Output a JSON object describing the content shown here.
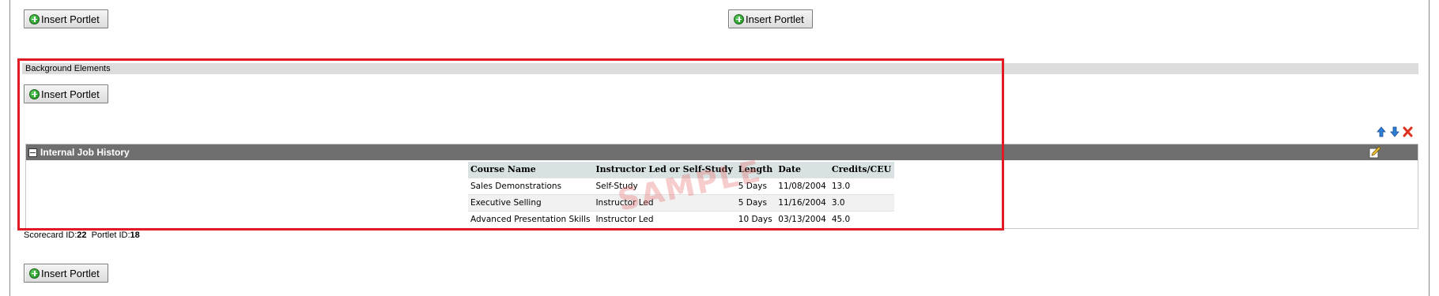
{
  "buttons": {
    "insert_portlet_label": "Insert Portlet"
  },
  "background_section": {
    "title": "Background Elements"
  },
  "portlet": {
    "title": "Internal Job History",
    "table": {
      "headers": [
        "Course Name",
        "Instructor Led or Self-Study",
        "Length",
        "Date",
        "Credits/CEU"
      ],
      "rows": [
        [
          "Sales Demonstrations",
          "Self-Study",
          "5 Days",
          "11/08/2004",
          "13.0"
        ],
        [
          "Executive Selling",
          "Instructor Led",
          "5 Days",
          "11/16/2004",
          "3.0"
        ],
        [
          "Advanced Presentation Skills",
          "Instructor Led",
          "10 Days",
          "03/13/2004",
          "45.0"
        ]
      ]
    },
    "watermark": "SAMPLE"
  },
  "ids": {
    "scorecard_label": "Scorecard ID:",
    "scorecard_value": "22",
    "portlet_label": "Portlet ID:",
    "portlet_value": "18"
  },
  "colors": {
    "highlight_outline": "#e01b24",
    "portlet_header": "#6f6f6f",
    "table_header": "#d9e2e2"
  },
  "icons": [
    "plus-circle-icon",
    "collapse-icon",
    "edit-icon",
    "move-up-icon",
    "move-down-icon",
    "delete-icon"
  ]
}
